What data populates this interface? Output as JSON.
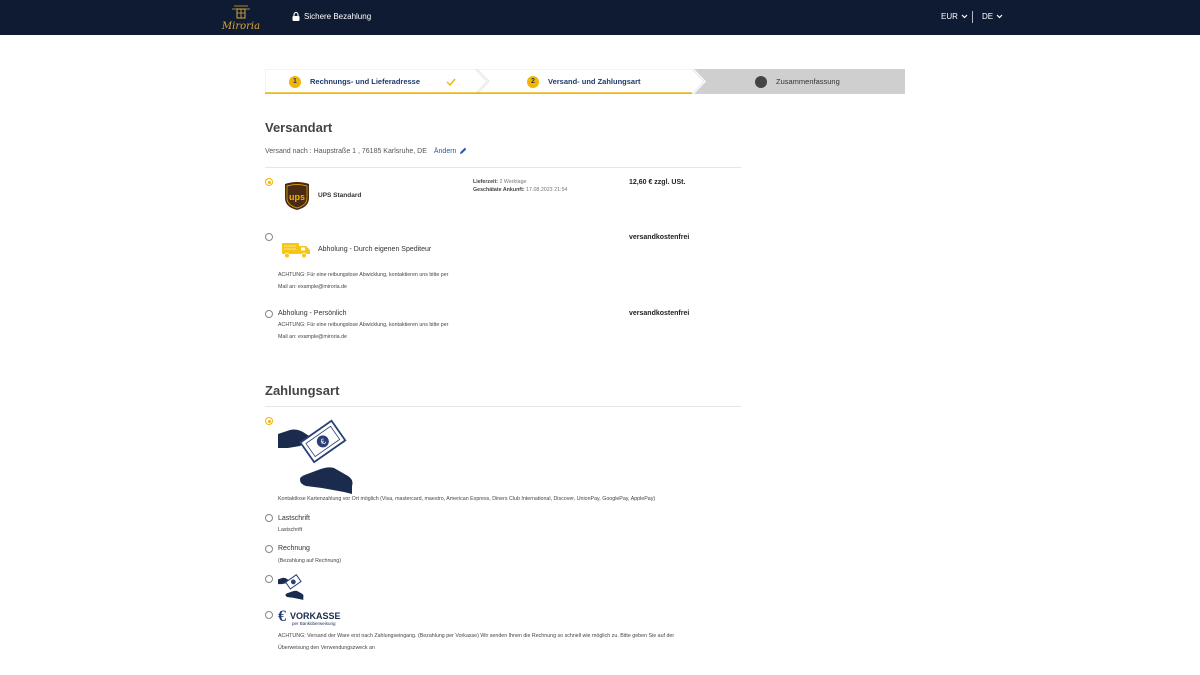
{
  "header": {
    "logo_text": "Miroria",
    "secure_label": "Sichere Bezahlung",
    "currency": "EUR",
    "language": "DE"
  },
  "stepper": {
    "steps": [
      {
        "number": "1",
        "label": "Rechnungs- und Lieferadresse",
        "state": "done"
      },
      {
        "number": "2",
        "label": "Versand- und Zahlungsart",
        "state": "active"
      },
      {
        "number": "3",
        "label": "Zusammenfassung",
        "state": "upcoming"
      }
    ]
  },
  "shipping": {
    "title": "Versandart",
    "ship_to": "Versand nach : Haupstraße 1 , 76185 Karlsruhe, DE",
    "change_label": "Ändern",
    "options": [
      {
        "name": "UPS Standard",
        "delivery_time_label": "Lieferzeit:",
        "delivery_time_value": "2 Werktage",
        "arrival_label": "Geschätate Ankunft:",
        "arrival_value": "17.08.2023 21:54",
        "price": "12,60 € zzgl. USt.",
        "selected": true,
        "icon": "ups-logo-icon"
      },
      {
        "name": "Abholung - Durch eigenen Spediteur",
        "note_line1": "ACHTUNG: Für eine reibungslose Abwicklung, kontaktieren uns bitte per",
        "note_line2": "Mail an: example@miroria.de",
        "price": "versandkostenfrei",
        "selected": false,
        "icon": "truck-icon"
      },
      {
        "name": "Abholung - Persönlich",
        "note_line1": "ACHTUNG: Für eine reibungslose Abwicklung, kontaktieren uns bitte per",
        "note_line2": "Mail an: example@miroria.de",
        "price": "versandkostenfrei",
        "selected": false
      }
    ]
  },
  "payment": {
    "title": "Zahlungsart",
    "options": [
      {
        "description": "Kontaktlose Kartenzahlung vor Ort möglich (Visa, mastercard, maestro, American Express, Diners Club International, Discover, UnionPay, GooglePay, ApplePay)",
        "selected": true,
        "icon": "cash-hand-icon"
      },
      {
        "name": "Lastschrift",
        "description": "Lastschrift",
        "selected": false
      },
      {
        "name": "Rechnung",
        "description": "(Bezahlung auf Rechnung)",
        "selected": false
      },
      {
        "selected": false,
        "icon": "cash-hand-icon"
      },
      {
        "logo_title": "VORKASSE",
        "logo_subtitle": "per Banküberweisung",
        "note_line1": "ACHTUNG: Versand der Ware erst nach Zahlungseingang. (Bezahlung per Vorkasse) Wir senden Ihnen die Rechnung so schnell wie möglich zu. Bitte geben Sie auf der",
        "note_line2": "Überweisung den Verwendungszweck an",
        "selected": false,
        "icon": "euro-icon"
      }
    ]
  },
  "colors": {
    "header_bg": "#0f1a33",
    "accent": "#f2b600",
    "link": "#2a5aa8",
    "navy": "#1e3a6e"
  }
}
